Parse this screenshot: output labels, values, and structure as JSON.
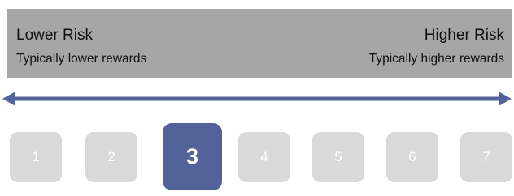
{
  "header": {
    "left_title": "Lower Risk",
    "left_subtitle": "Typically lower rewards",
    "right_title": "Higher Risk",
    "right_subtitle": "Typically higher rewards"
  },
  "scale": {
    "items": [
      "1",
      "2",
      "3",
      "4",
      "5",
      "6",
      "7"
    ],
    "selected": "3"
  },
  "colors": {
    "header_bg": "#a6a6a6",
    "arrow": "#536298",
    "box": "#d9d9d9",
    "selected_box": "#536298"
  }
}
